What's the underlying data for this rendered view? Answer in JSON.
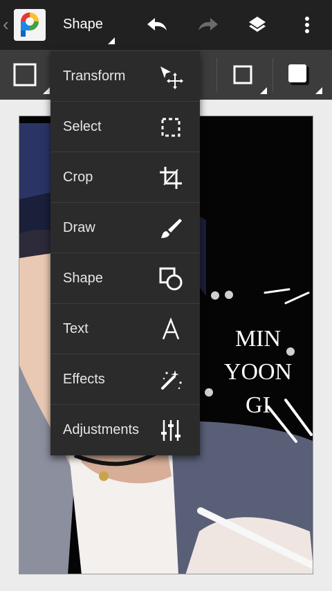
{
  "header": {
    "mode_title": "Shape",
    "icons": [
      "chevron-left-icon",
      "app-logo",
      "undo-icon",
      "redo-icon",
      "layers-icon",
      "more-vert-icon"
    ]
  },
  "subtoolbar": {
    "icons": [
      "rectangle-outline-icon",
      "square-outline-icon",
      "filled-square-icon"
    ]
  },
  "menu": {
    "items": [
      {
        "label": "Transform",
        "icon": "transform-icon"
      },
      {
        "label": "Select",
        "icon": "select-icon"
      },
      {
        "label": "Crop",
        "icon": "crop-icon"
      },
      {
        "label": "Draw",
        "icon": "brush-icon"
      },
      {
        "label": "Shape",
        "icon": "shape-icon"
      },
      {
        "label": "Text",
        "icon": "text-icon"
      },
      {
        "label": "Effects",
        "icon": "magic-wand-icon"
      },
      {
        "label": "Adjustments",
        "icon": "adjustments-icon"
      }
    ]
  },
  "canvas": {
    "text_lines": [
      "MIN",
      "YOON",
      "GI"
    ]
  },
  "colors": {
    "topbar": "#212121",
    "subbar": "#3c3c3c",
    "menu": "#2b2b2b",
    "background": "#ececec"
  }
}
